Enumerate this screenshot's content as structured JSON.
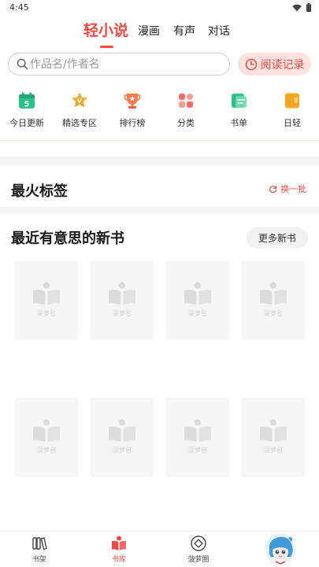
{
  "status_bar": {
    "time": "4:45"
  },
  "top_tabs": [
    {
      "label": "轻小说",
      "active": true
    },
    {
      "label": "漫画",
      "active": false
    },
    {
      "label": "有声",
      "active": false
    },
    {
      "label": "对话",
      "active": false
    }
  ],
  "search": {
    "placeholder": "作品名/作者名",
    "value": ""
  },
  "history_button": {
    "label": "阅读记录"
  },
  "quick_nav": [
    {
      "label": "今日更新",
      "icon": "calendar-icon",
      "badge": "5"
    },
    {
      "label": "精选专区",
      "icon": "star-badge-icon",
      "badge": "V"
    },
    {
      "label": "排行榜",
      "icon": "trophy-icon"
    },
    {
      "label": "分类",
      "icon": "grid-icon"
    },
    {
      "label": "书单",
      "icon": "booklist-icon"
    },
    {
      "label": "日轻",
      "icon": "japanese-novel-icon"
    }
  ],
  "hot_tags": {
    "title": "最火标签",
    "refresh_label": "换一批"
  },
  "new_books": {
    "title": "最近有意思的新书",
    "more_label": "更多新书",
    "placeholder_text": "菠萝包"
  },
  "bottom_nav": [
    {
      "label": "书架",
      "icon": "bookshelf-icon",
      "active": false
    },
    {
      "label": "书库",
      "icon": "library-icon",
      "active": true
    },
    {
      "label": "菠萝圈",
      "icon": "community-icon",
      "active": false
    }
  ],
  "colors": {
    "accent": "#ef4b44",
    "accent_soft": "#fde2e0",
    "green": "#2ec08a",
    "orange": "#f5a623",
    "placeholder": "#f5f5f5"
  }
}
